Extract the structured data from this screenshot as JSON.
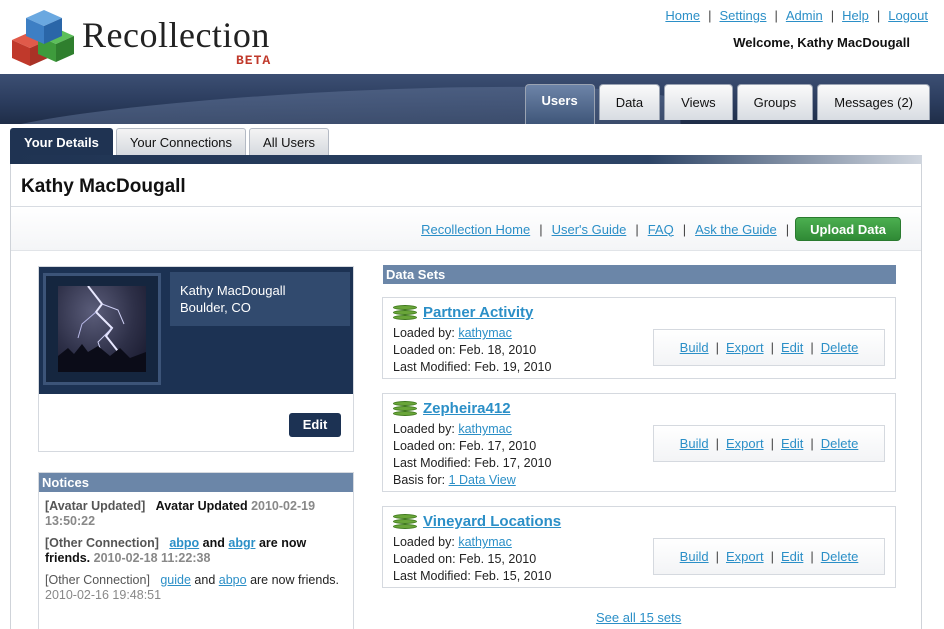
{
  "app": {
    "brand": "Recollection",
    "badge": "BETA"
  },
  "top_links": [
    "Home",
    "Settings",
    "Admin",
    "Help",
    "Logout"
  ],
  "welcome": "Welcome, Kathy MacDougall",
  "main_tabs": [
    {
      "label": "Users",
      "active": true
    },
    {
      "label": "Data",
      "active": false
    },
    {
      "label": "Views",
      "active": false
    },
    {
      "label": "Groups",
      "active": false
    },
    {
      "label": "Messages (2)",
      "active": false
    }
  ],
  "sub_tabs": [
    {
      "label": "Your Details",
      "active": true
    },
    {
      "label": "Your Connections",
      "active": false
    },
    {
      "label": "All Users",
      "active": false
    }
  ],
  "page_title": "Kathy MacDougall",
  "action_links": [
    "Recollection Home",
    "User's Guide",
    "FAQ",
    "Ask the Guide"
  ],
  "upload_label": "Upload Data",
  "profile": {
    "name": "Kathy MacDougall",
    "location": "Boulder, CO",
    "edit_label": "Edit"
  },
  "notices": {
    "title": "Notices",
    "items": [
      {
        "kind": "[Avatar Updated]",
        "text": "Avatar Updated",
        "timestamp": "2010-02-19 13:50:22"
      },
      {
        "kind": "[Other Connection]",
        "user1": "abpo",
        "and": "and",
        "user2": "abgr",
        "text": "are now friends.",
        "timestamp": "2010-02-18 11:22:38"
      },
      {
        "kind": "[Other Connection]",
        "user1": "guide",
        "and": "and",
        "user2": "abpo",
        "text": "are now friends.",
        "timestamp": "2010-02-16 19:48:51"
      }
    ]
  },
  "datasets": {
    "title": "Data Sets",
    "loaded_by_label": "Loaded by:",
    "loaded_on_label": "Loaded on:",
    "last_modified_label": "Last Modified:",
    "basis_for_label": "Basis for:",
    "ops": [
      "Build",
      "Export",
      "Edit",
      "Delete"
    ],
    "items": [
      {
        "name": "Partner Activity",
        "loaded_by": "kathymac",
        "loaded_on": "Feb. 18, 2010",
        "last_modified": "Feb. 19, 2010"
      },
      {
        "name": "Zepheira412",
        "loaded_by": "kathymac",
        "loaded_on": "Feb. 17, 2010",
        "last_modified": "Feb. 17, 2010",
        "basis_for": "1 Data View"
      },
      {
        "name": "Vineyard Locations",
        "loaded_by": "kathymac",
        "loaded_on": "Feb. 15, 2010",
        "last_modified": "Feb. 15, 2010"
      }
    ],
    "see_all": "See all 15 sets"
  }
}
